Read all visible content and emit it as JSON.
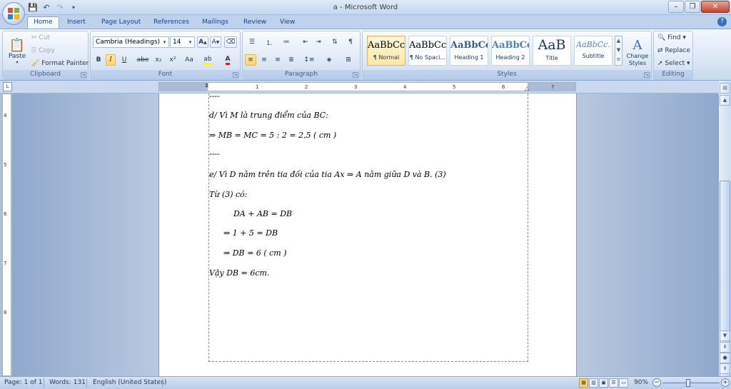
{
  "window": {
    "title": "a - Microsoft Word",
    "buttons": {
      "minimize": "–",
      "restore": "❐",
      "close": "✕"
    }
  },
  "quick_access": [
    "save",
    "undo",
    "redo",
    "customize"
  ],
  "tabs": [
    "Home",
    "Insert",
    "Page Layout",
    "References",
    "Mailings",
    "Review",
    "View"
  ],
  "ribbon": {
    "clipboard": {
      "label": "Clipboard",
      "paste": "Paste",
      "cut": "Cut",
      "copy": "Copy",
      "format_painter": "Format Painter"
    },
    "font": {
      "label": "Font",
      "family": "Cambria (Headings)",
      "size": "14",
      "bold": "B",
      "italic": "I",
      "underline": "U",
      "strike": "abe",
      "subscript": "x₂",
      "superscript": "x²",
      "change_case": "Aa"
    },
    "paragraph": {
      "label": "Paragraph"
    },
    "styles": {
      "label": "Styles",
      "items": [
        {
          "sample": "AaBbCcI",
          "name": "¶ Normal"
        },
        {
          "sample": "AaBbCcI",
          "name": "¶ No Spaci..."
        },
        {
          "sample": "AaBbCc",
          "name": "Heading 1"
        },
        {
          "sample": "AaBbCc",
          "name": "Heading 2"
        },
        {
          "sample": "AaB",
          "name": "Title"
        },
        {
          "sample": "AaBbCc.",
          "name": "Subtitle"
        }
      ],
      "change_styles": "Change Styles"
    },
    "editing": {
      "label": "Editing",
      "find": "Find",
      "replace": "Replace",
      "select": "Select"
    }
  },
  "ruler": {
    "ticks": [
      "1",
      "2",
      "3",
      "4",
      "5",
      "6",
      "7"
    ],
    "vticks": [
      "4",
      "5",
      "6",
      "7",
      "8"
    ]
  },
  "document": {
    "lines": [
      "----",
      "d/ Vì M là trung điểm của BC:",
      "⇒ MB = MC = 5 : 2 = 2,5 ( cm )",
      "----",
      "e/ Vì D nằm trên tia đối của tia Ax ⇒ A nằm giữa D và B.  (3)",
      "Từ (3) có:",
      "DA + AB = DB",
      "⇒  1  +  5   = DB",
      "⇒ DB = 6 ( cm )",
      "Vậy DB = 6cm."
    ]
  },
  "status": {
    "page": "Page: 1 of 1",
    "words": "Words: 131",
    "language": "English (United States)",
    "zoom": "90%"
  }
}
